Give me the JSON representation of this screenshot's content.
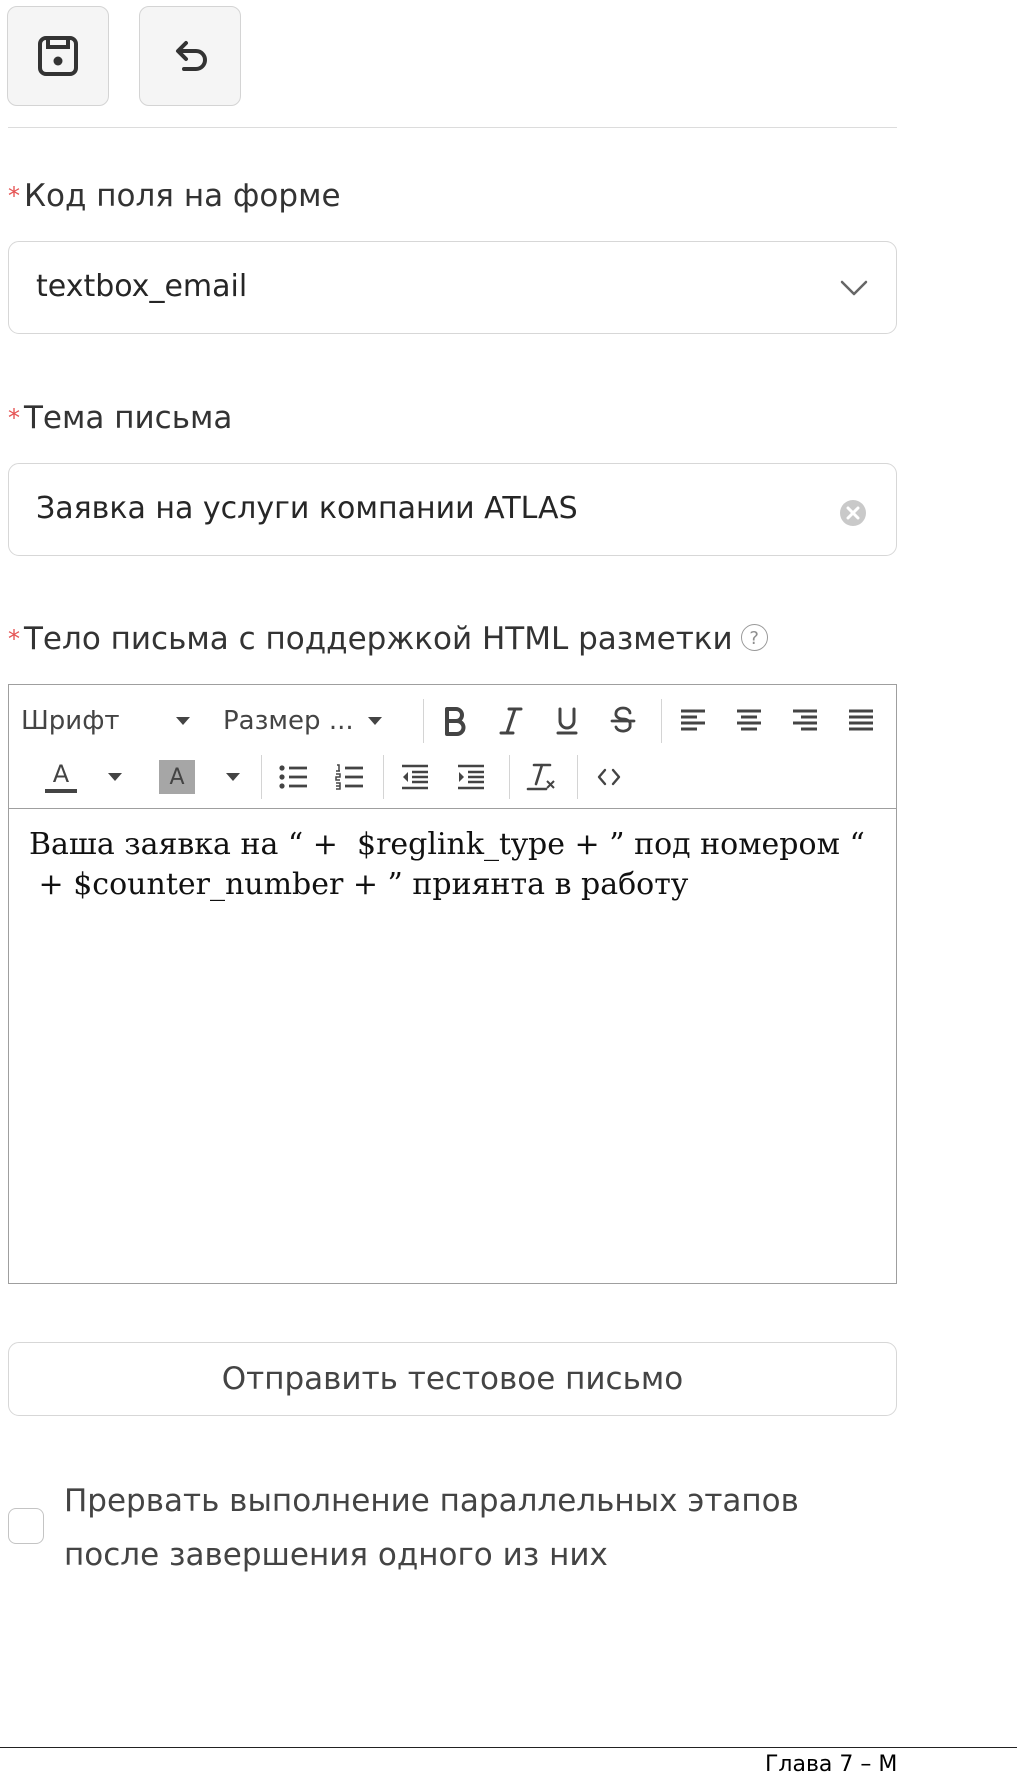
{
  "form": {
    "field_code": {
      "label": "Код поля на форме",
      "value": "textbox_email"
    },
    "subject": {
      "label": "Тема письма",
      "value": "Заявка на услуги компании ATLAS"
    },
    "body": {
      "label": "Тело письма с поддержкой HTML разметки",
      "help_glyph": "?",
      "content": "Ваша заявка на “ +  $reglink_type + ” под номером “\n + $counter_number + ” приянта в работу"
    },
    "required_marker": "*"
  },
  "editor_toolbar": {
    "font_label": "Шрифт",
    "size_label": "Размер ...",
    "text_color_glyph": "A",
    "bg_color_glyph": "A"
  },
  "send_test_button": "Отправить тестовое письмо",
  "interrupt_checkbox": {
    "checked": false,
    "line1": "Прервать выполнение параллельных этапов",
    "line2": "после завершения одного из них"
  },
  "footer_caption": "Глава 7 – М",
  "colors": {
    "required": "#e55353",
    "border": "#d7d7d7",
    "text": "#333333"
  }
}
